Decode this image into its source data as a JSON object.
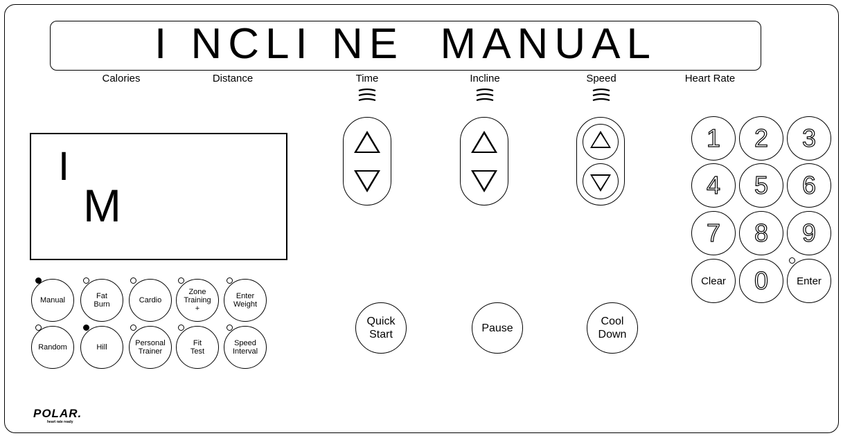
{
  "banner": {
    "text": "I NCLI NE  MANUAL"
  },
  "labels": {
    "calories": "Calories",
    "distance": "Distance",
    "time": "Time",
    "incline": "Incline",
    "speed": "Speed",
    "heart_rate": "Heart Rate"
  },
  "display": {
    "left_char": "I",
    "right_char": "M"
  },
  "programs": {
    "manual": "Manual",
    "fat_burn": "Fat\nBurn",
    "cardio": "Cardio",
    "zone_training": "Zone\nTraining\n+",
    "enter_weight": "Enter\nWeight",
    "random": "Random",
    "hill": "Hill",
    "personal_trainer": "Personal\nTrainer",
    "fit_test": "Fit\nTest",
    "speed_interval": "Speed\nInterval"
  },
  "keypad": {
    "keys": [
      "1",
      "2",
      "3",
      "4",
      "5",
      "6",
      "7",
      "8",
      "9"
    ],
    "clear": "Clear",
    "zero": "0",
    "enter": "Enter"
  },
  "controls": {
    "quick_start": "Quick\nStart",
    "pause": "Pause",
    "cool_down": "Cool\nDown"
  },
  "brand": {
    "logo": "POLAR.",
    "tagline": "heart rate ready"
  }
}
